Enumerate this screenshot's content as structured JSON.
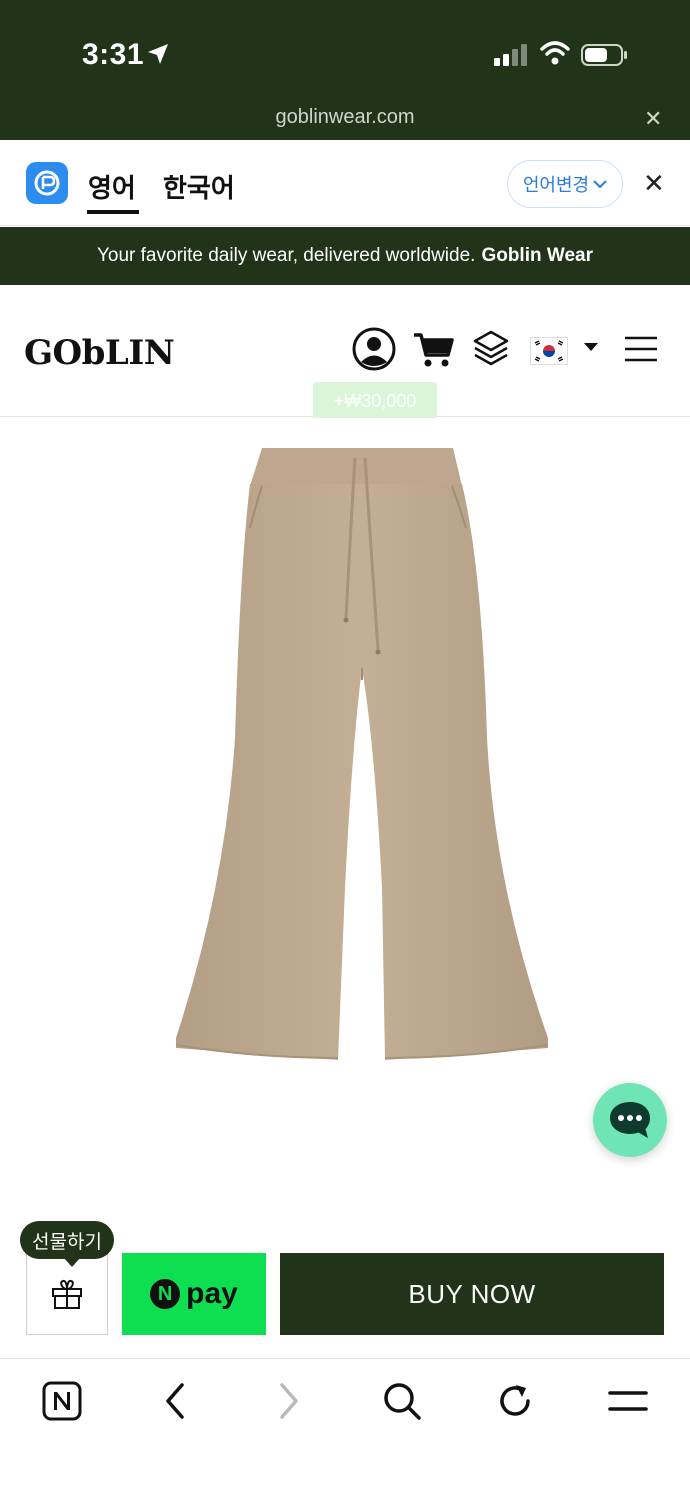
{
  "status_bar": {
    "time": "3:31",
    "url": "goblinwear.com",
    "close": "✕"
  },
  "translate_bar": {
    "tab_active": "영어",
    "tab_inactive": "한국어",
    "change_language": "언어변경",
    "close": "✕"
  },
  "banner": {
    "text": "Your favorite daily wear, delivered worldwide.",
    "brand": "Goblin Wear"
  },
  "header": {
    "brand": "GObLIN",
    "reward_badge": "+₩30,000",
    "icons": [
      "user-icon",
      "cart-icon",
      "layers-icon",
      "korea-flag-icon",
      "caret-down-icon",
      "menu-icon"
    ]
  },
  "product": {
    "image": "beige flared sweatpants"
  },
  "actions": {
    "gift_tooltip": "선물하기",
    "npay_n": "N",
    "npay_label": "pay",
    "buy_now": "BUY NOW"
  },
  "browser_nav": [
    "naver-icon",
    "back-icon",
    "forward-icon",
    "search-icon",
    "refresh-icon",
    "menu-icon"
  ],
  "colors": {
    "brand_green": "#213318",
    "npay_green": "#0ddf51",
    "chat_mint": "#6fe4b4",
    "accent_blue": "#2d8cf0"
  }
}
